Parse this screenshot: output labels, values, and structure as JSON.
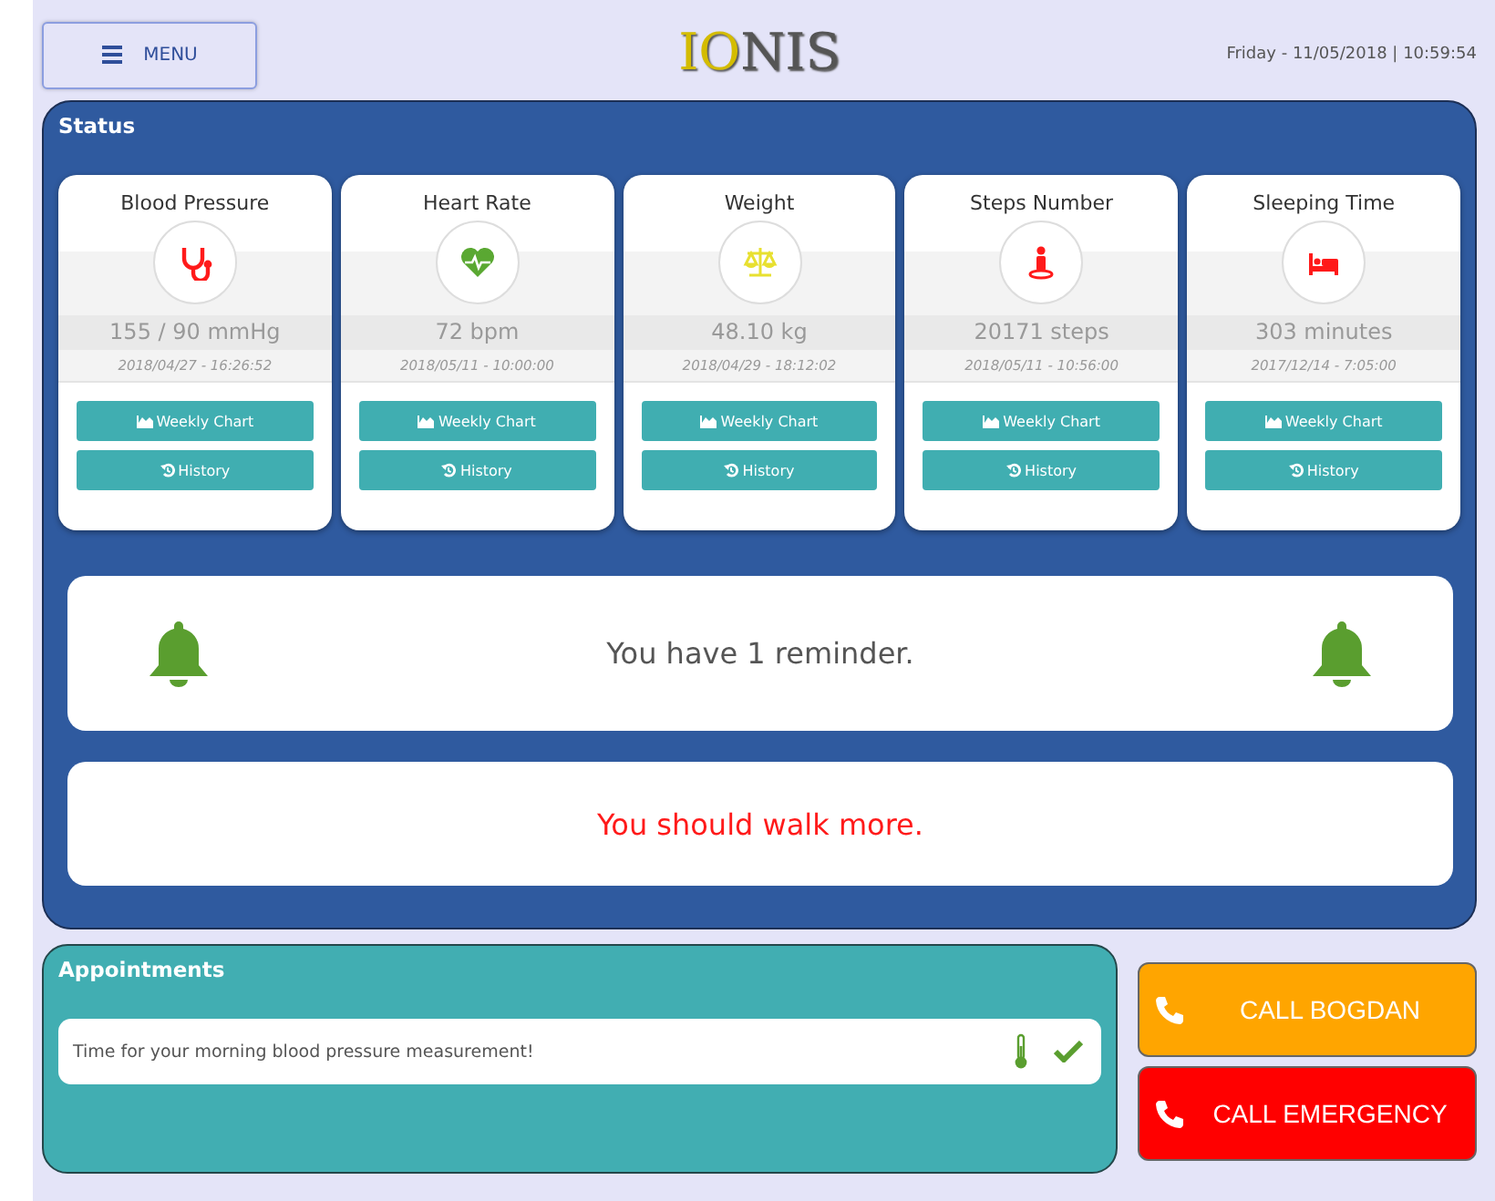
{
  "header": {
    "menu_label": "MENU",
    "logo_accent": "IO",
    "logo_rest": "NIS",
    "datetime": "Friday - 11/05/2018 | 10:59:54"
  },
  "status": {
    "title": "Status",
    "cards": [
      {
        "title": "Blood Pressure",
        "kind": "stethoscope",
        "color": "#ff1a1a",
        "value": "155 / 90 mmHg",
        "time": "2018/04/27 - 16:26:52",
        "chart_label": "Weekly Chart",
        "history_label": "History"
      },
      {
        "title": "Heart Rate",
        "kind": "heart",
        "color": "#5aa832",
        "value": "72 bpm",
        "time": "2018/05/11 - 10:00:00",
        "chart_label": "Weekly Chart",
        "history_label": "History"
      },
      {
        "title": "Weight",
        "kind": "scale",
        "color": "#e8e030",
        "value": "48.10 kg",
        "time": "2018/04/29 - 18:12:02",
        "chart_label": "Weekly Chart",
        "history_label": "History"
      },
      {
        "title": "Steps Number",
        "kind": "person",
        "color": "#ff1a1a",
        "value": "20171 steps",
        "time": "2018/05/11 - 10:56:00",
        "chart_label": "Weekly Chart",
        "history_label": "History"
      },
      {
        "title": "Sleeping Time",
        "kind": "bed",
        "color": "#ff1a1a",
        "value": "303 minutes",
        "time": "2017/12/14 - 7:05:00",
        "chart_label": "Weekly Chart",
        "history_label": "History"
      }
    ],
    "reminder": "You have 1 reminder.",
    "advice": "You should walk more."
  },
  "appointments": {
    "title": "Appointments",
    "items": [
      {
        "text": "Time for your morning blood pressure measurement!",
        "done": true
      }
    ]
  },
  "calls": [
    {
      "label": "CALL BOGDAN",
      "color": "#ffa500"
    },
    {
      "label": "CALL EMERGENCY",
      "color": "#ff0000"
    }
  ]
}
